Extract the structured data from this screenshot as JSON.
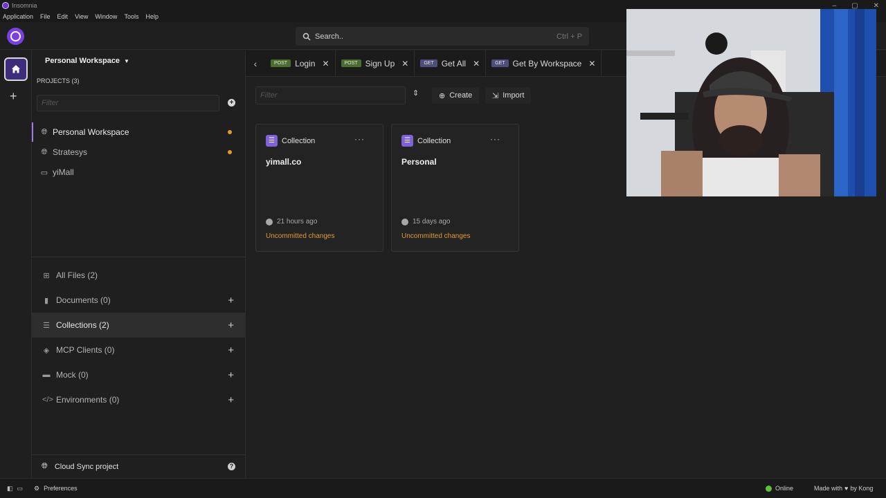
{
  "window": {
    "title": "Insomnia"
  },
  "menu": [
    "Application",
    "File",
    "Edit",
    "View",
    "Window",
    "Tools",
    "Help"
  ],
  "search": {
    "placeholder": "Search..",
    "shortcut": "Ctrl + P"
  },
  "sidebar": {
    "workspace_title": "Personal Workspace",
    "projects_label": "PROJECTS (3)",
    "filter_placeholder": "Filter",
    "projects": [
      {
        "label": "Personal Workspace",
        "icon": "globe-icon",
        "active": true,
        "dot": true
      },
      {
        "label": "Stratesys",
        "icon": "globe-icon",
        "active": false,
        "dot": true
      },
      {
        "label": "yiMall",
        "icon": "laptop-icon",
        "active": false,
        "dot": false
      }
    ],
    "categories": [
      {
        "label": "All Files (2)",
        "icon": "grid-icon",
        "has_plus": false
      },
      {
        "label": "Documents (0)",
        "icon": "document-icon",
        "has_plus": true
      },
      {
        "label": "Collections (2)",
        "icon": "list-icon",
        "has_plus": true,
        "active": true
      },
      {
        "label": "MCP Clients (0)",
        "icon": "mcp-icon",
        "has_plus": true
      },
      {
        "label": "Mock (0)",
        "icon": "server-icon",
        "has_plus": true
      },
      {
        "label": "Environments (0)",
        "icon": "code-icon",
        "has_plus": true
      }
    ],
    "cloud_sync": "Cloud Sync project"
  },
  "tabs": [
    {
      "method": "POST",
      "label": "Login"
    },
    {
      "method": "POST",
      "label": "Sign Up"
    },
    {
      "method": "GET",
      "label": "Get All"
    },
    {
      "method": "GET",
      "label": "Get By Workspace"
    }
  ],
  "toolbar": {
    "filter_placeholder": "Filter",
    "create_label": "Create",
    "import_label": "Import"
  },
  "cards": [
    {
      "type": "Collection",
      "name": "yimall.co",
      "time": "21 hours ago",
      "status": "Uncommitted changes"
    },
    {
      "type": "Collection",
      "name": "Personal",
      "time": "15 days ago",
      "status": "Uncommitted changes"
    }
  ],
  "statusbar": {
    "preferences": "Preferences",
    "online": "Online",
    "made_with": "Made with",
    "by": "by Kong"
  },
  "colors": {
    "accent": "#7a3fe0",
    "warning": "#e59a2d",
    "online": "#5fc13b",
    "post": "#4b6d2e",
    "get": "#4d4f7a"
  }
}
